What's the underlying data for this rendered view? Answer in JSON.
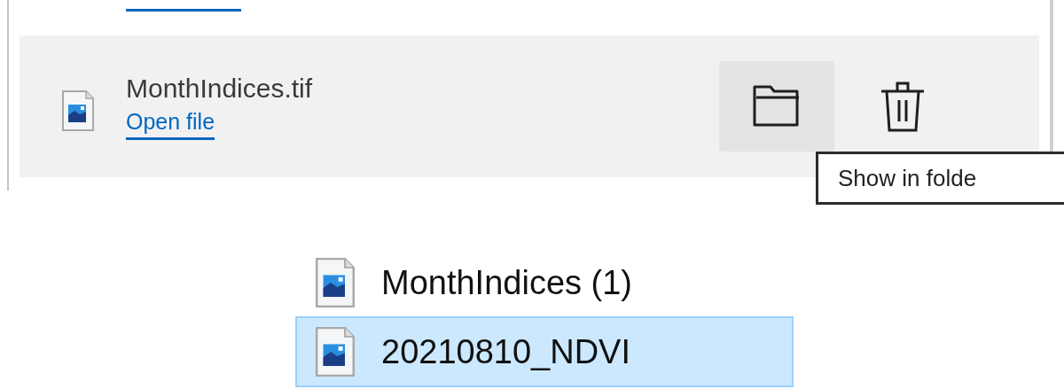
{
  "download": {
    "file_name": "MonthIndices.tif",
    "action_link": "Open file",
    "folder_button": {
      "hovered": true
    }
  },
  "tooltip": {
    "text": "Show in folde"
  },
  "explorer": {
    "files": [
      {
        "name": "MonthIndices (1)",
        "selected": false
      },
      {
        "name": "20210810_NDVI",
        "selected": true
      }
    ]
  }
}
